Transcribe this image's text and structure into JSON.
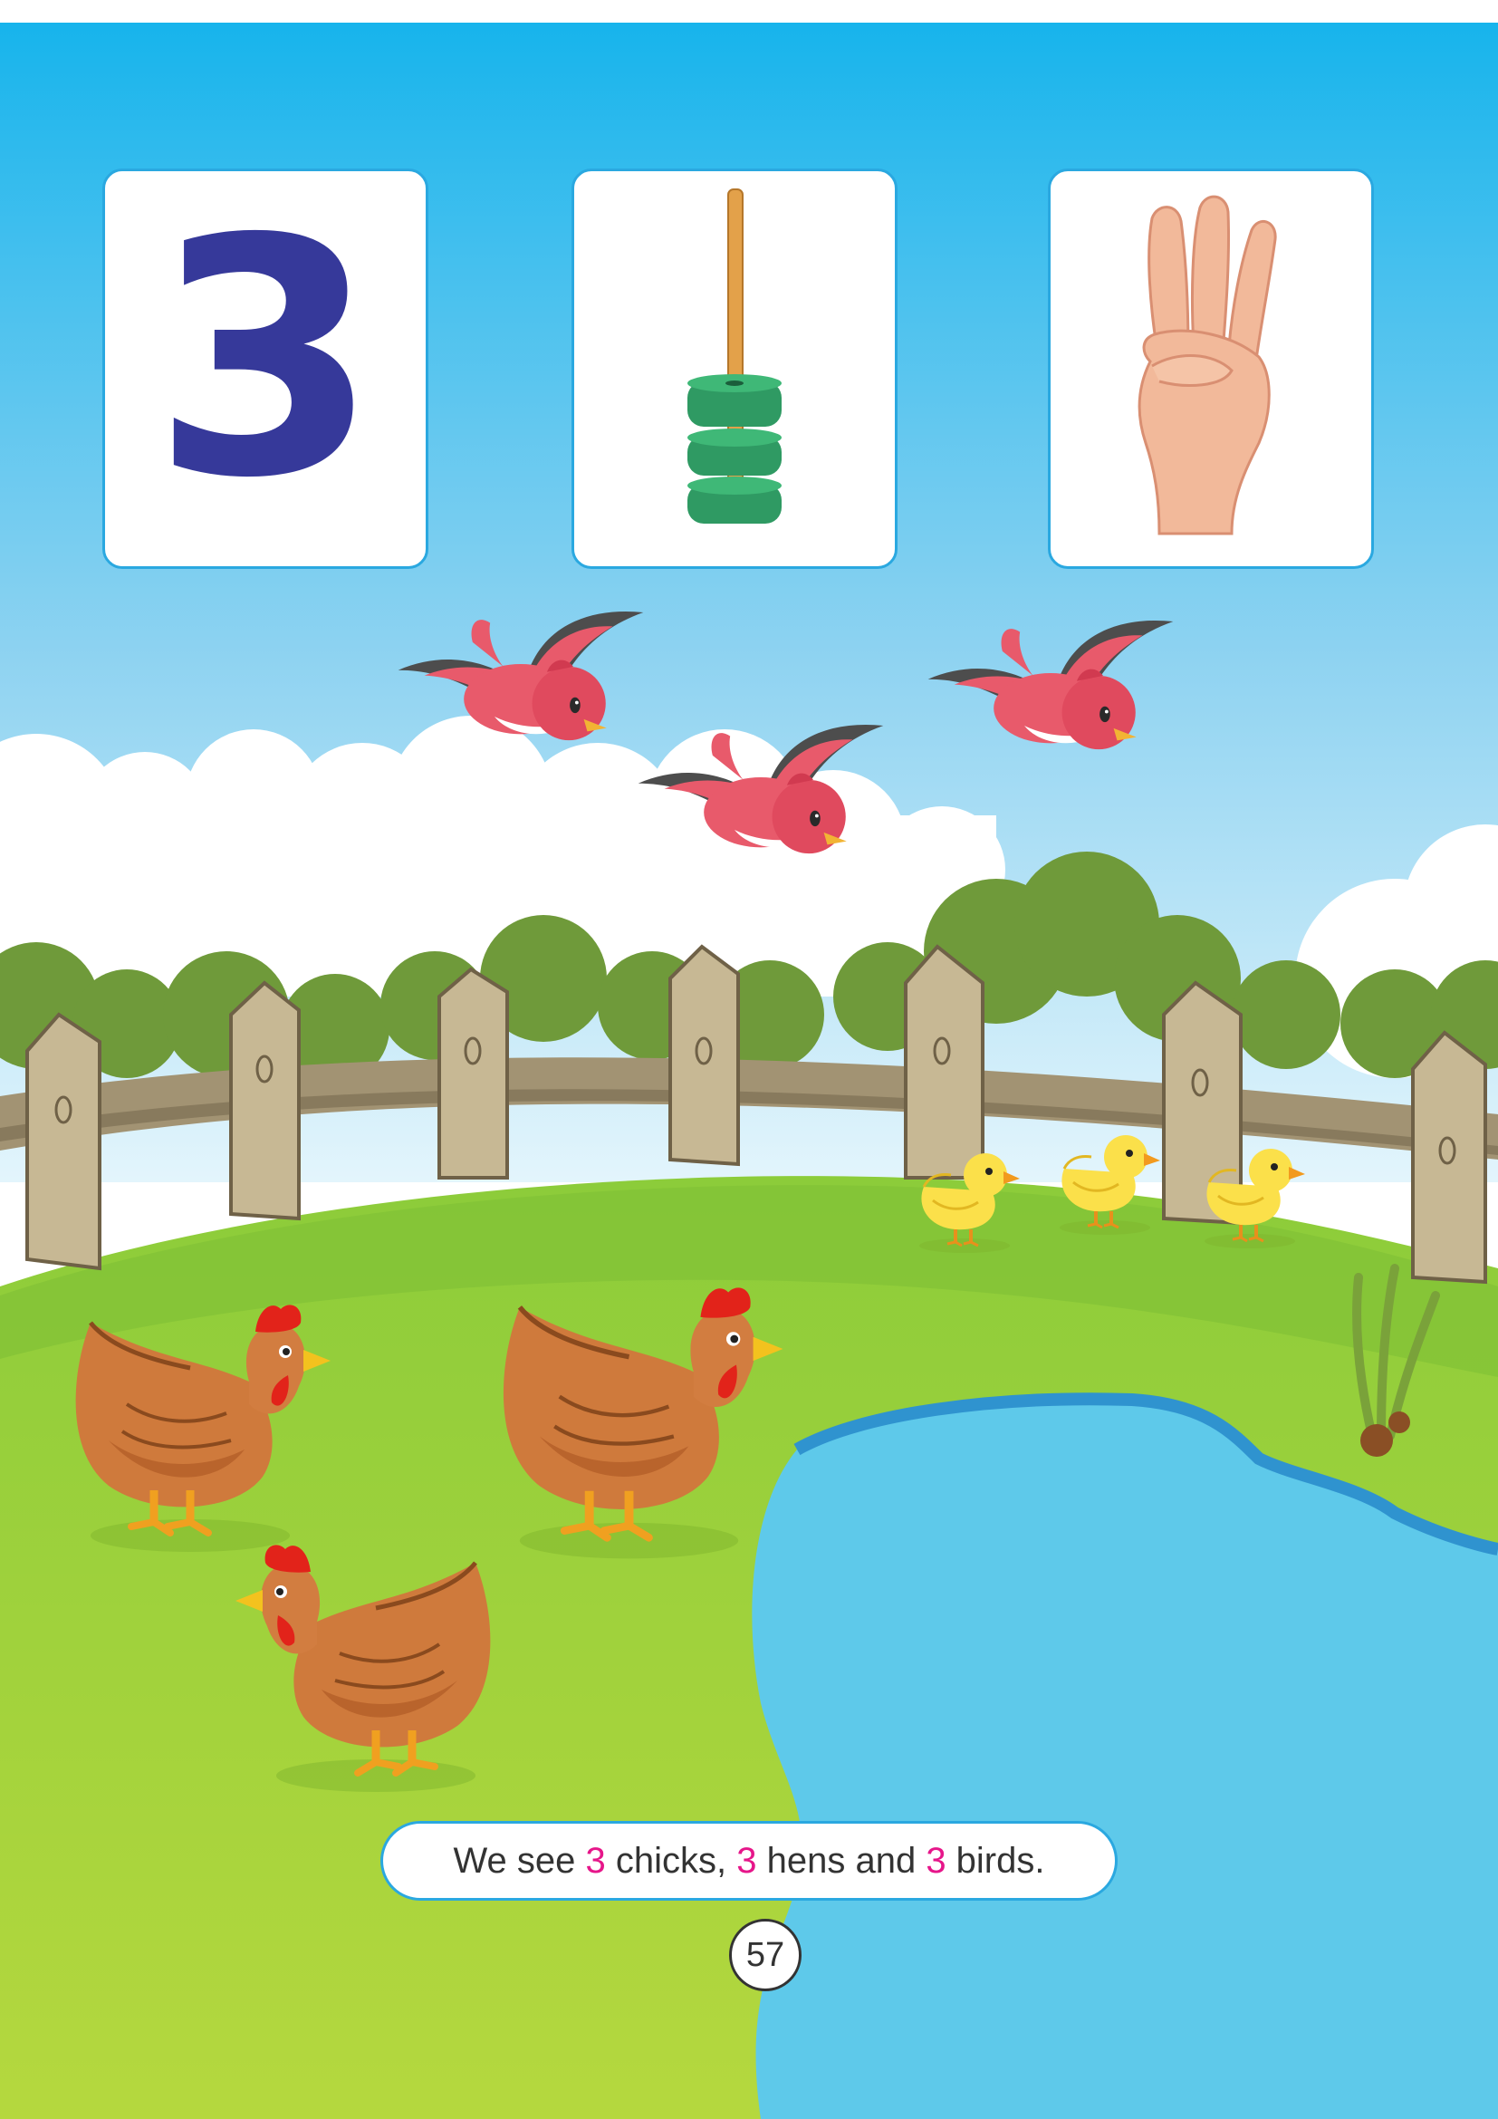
{
  "counting_cards": {
    "numeral": "3"
  },
  "caption": {
    "part1": "We see ",
    "chicks_count": "3",
    "part2": " chicks, ",
    "hens_count": "3",
    "part3": " hens and ",
    "birds_count": "3",
    "part4": " birds."
  },
  "page_number": "57",
  "colors": {
    "sky_top": "#17b4ec",
    "sky_bottom": "#dff3fb",
    "grass": "#9fd13c",
    "pond": "#5ec9ea",
    "numeral": "#36399a",
    "highlight_number": "#e6168a",
    "card_border": "#2aa8e0"
  },
  "icons": {
    "rings": "stacking-rings-icon",
    "hand": "three-fingers-hand-icon",
    "bird": "red-bird-icon",
    "hen": "hen-icon",
    "chick": "chick-icon"
  }
}
